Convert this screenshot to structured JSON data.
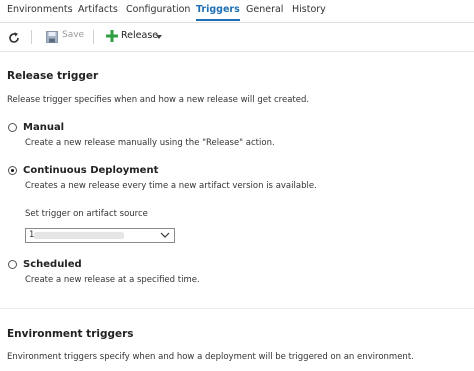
{
  "tabs": {
    "environments": "Environments",
    "artifacts": "Artifacts",
    "configuration": "Configuration",
    "triggers": "Triggers",
    "general": "General",
    "history": "History"
  },
  "toolbar": {
    "save_label": "Save",
    "release_label": "Release"
  },
  "release_trigger": {
    "title": "Release trigger",
    "description": "Release trigger specifies when and how a new release will get created.",
    "options": [
      {
        "label": "Manual",
        "description": "Create a new release manually using the \"Release\" action.",
        "selected": false
      },
      {
        "label": "Continuous Deployment",
        "description": "Creates a new release every time a new artifact version is available.",
        "selected": true
      },
      {
        "label": "Scheduled",
        "description": "Create a new release at a specified time.",
        "selected": false
      }
    ],
    "artifact_source_label": "Set trigger on artifact source",
    "artifact_source_value": "1"
  },
  "environment_triggers": {
    "title": "Environment triggers",
    "description": "Environment triggers specify when and how a deployment will be triggered on an environment."
  },
  "colors": {
    "accent": "#1f6fb5",
    "plus_icon": "#2e9e3e"
  }
}
